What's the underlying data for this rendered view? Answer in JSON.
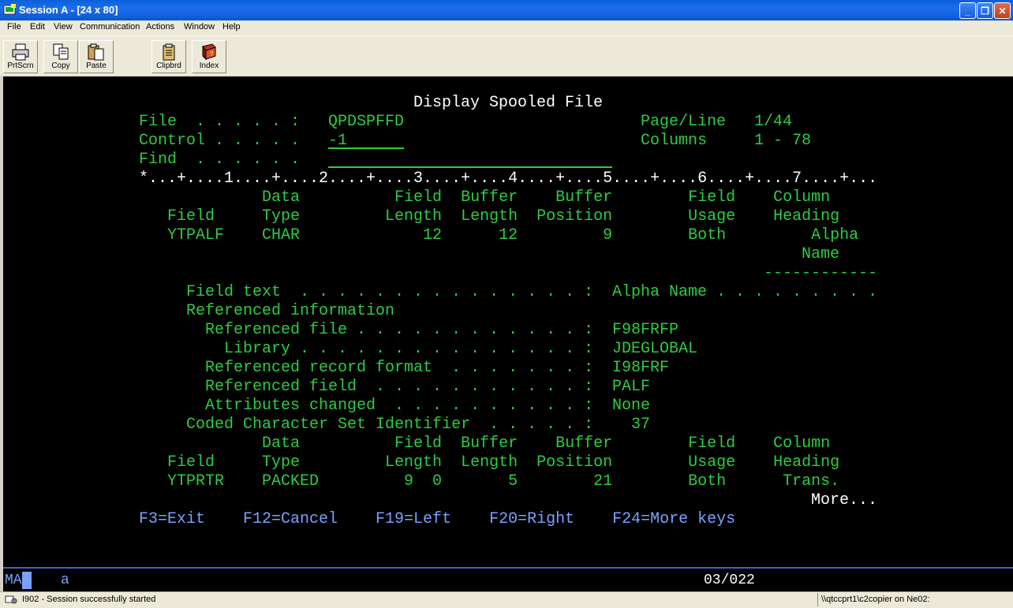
{
  "window": {
    "title": "Session A - [24 x 80]"
  },
  "menu": [
    "File",
    "Edit",
    "View",
    "Communication",
    "Actions",
    "Window",
    "Help"
  ],
  "toolbar": [
    {
      "label": "PrtScrn",
      "icon": "printer-icon"
    },
    {
      "label": "Copy",
      "icon": "copy-icon"
    },
    {
      "label": "Paste",
      "icon": "paste-icon"
    },
    {
      "label": "Clipbrd",
      "icon": "clipboard-icon"
    },
    {
      "label": "Index",
      "icon": "index-book-icon"
    }
  ],
  "screen": {
    "title": "Display Spooled File",
    "file_label": "File  . . . . . :",
    "file_value": "QPDSPFFD",
    "pageline_label": "Page/Line",
    "pageline_value": "1/44",
    "control_label": "Control . . . . .",
    "control_value": "-1",
    "columns_label": "Columns",
    "columns_value": "1 - 78",
    "find_label": "Find  . . . . . .",
    "ruler": "*...+....1....+....2....+....3....+....4....+....5....+....6....+....7....+...",
    "field1": {
      "hdr1": "             Data          Field  Buffer    Buffer        Field    Column",
      "hdr2": "   Field     Type         Length  Length  Position        Usage    Heading",
      "row": "   YTPALF    CHAR             12      12         9        Both         Alpha",
      "heading2": "Name",
      "heading_dashes": "------------"
    },
    "details": [
      {
        "label": "     Field text  . . . . . . . . . . . . . . . :",
        "value": "Alpha Name . . . . . . . . ."
      },
      {
        "label": "     Referenced information",
        "value": ""
      },
      {
        "label": "       Referenced file . . . . . . . . . . . . :",
        "value": "F98FRFP"
      },
      {
        "label": "         Library . . . . . . . . . . . . . . . :",
        "value": "JDEGLOBAL"
      },
      {
        "label": "       Referenced record format  . . . . . . . :",
        "value": "I98FRF"
      },
      {
        "label": "       Referenced field  . . . . . . . . . . . :",
        "value": "PALF"
      },
      {
        "label": "       Attributes changed  . . . . . . . . . . :",
        "value": "None"
      },
      {
        "label": "     Coded Character Set Identifier  . . . . . :",
        "value": "  37"
      }
    ],
    "field2": {
      "hdr1": "             Data          Field  Buffer    Buffer        Field    Column",
      "hdr2": "   Field     Type         Length  Length  Position        Usage    Heading",
      "row": "   YTPRTR    PACKED         9  0       5        21        Both      Trans."
    },
    "more": "More...",
    "fkeys": "F3=Exit    F12=Cancel    F19=Left    F20=Right    F24=More keys"
  },
  "oia": {
    "mode": "MA",
    "indicator": "a",
    "cursor_pos": "03/022"
  },
  "status": {
    "message": "I902 - Session successfully started",
    "host": "\\\\qtccprt1\\c2copier on Ne02:"
  }
}
